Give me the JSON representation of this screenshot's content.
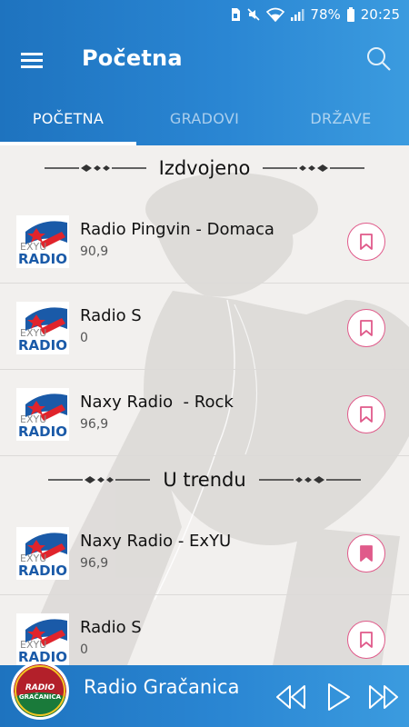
{
  "status_bar": {
    "battery": "78%",
    "time": "20:25"
  },
  "app_bar": {
    "title": "Početna",
    "menu_icon": "hamburger-menu-icon",
    "search_icon": "search-icon"
  },
  "tabs": [
    {
      "label": "POČETNA",
      "active": true
    },
    {
      "label": "GRADOVI",
      "active": false
    },
    {
      "label": "DRŽAVE",
      "active": false
    }
  ],
  "sections": [
    {
      "title": "Izdvojeno",
      "items": [
        {
          "name": "Radio Pingvin - Domaca",
          "frequency": "90,9",
          "bookmarked": false
        },
        {
          "name": "Radio S",
          "frequency": "0",
          "bookmarked": false
        },
        {
          "name": "Naxy Radio  - Rock",
          "frequency": "96,9",
          "bookmarked": false
        }
      ]
    },
    {
      "title": "U trendu",
      "items": [
        {
          "name": "Naxy Radio - ExYU",
          "frequency": "96,9",
          "bookmarked": true
        },
        {
          "name": "Radio S",
          "frequency": "0",
          "bookmarked": false
        }
      ]
    }
  ],
  "logo": {
    "line1": "EXYU",
    "line2": "RADIO"
  },
  "player": {
    "station": "Radio Gračanica",
    "logo_text_1": "RADIO",
    "logo_text_2": "GRAČANICA"
  },
  "colors": {
    "accent": "#2a86d3",
    "bookmark": "#e05a8a",
    "background": "#f2f0ee"
  }
}
